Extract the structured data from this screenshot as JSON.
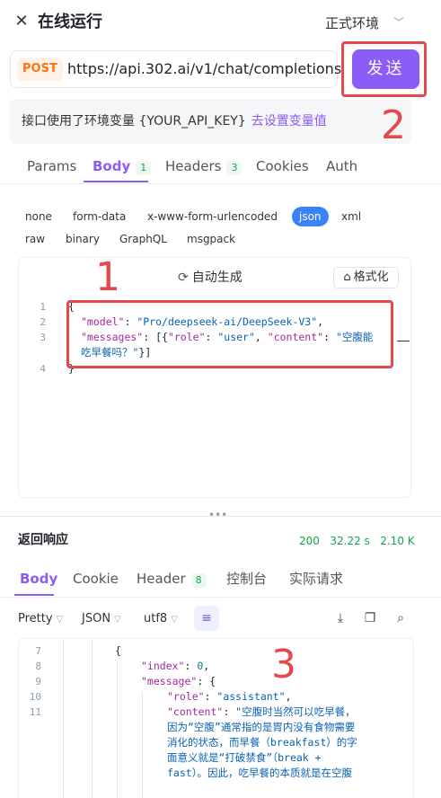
{
  "header": {
    "title": "在线运行",
    "environment": "正式环境"
  },
  "request": {
    "method": "POST",
    "url": "https://api.302.ai/v1/chat/completions",
    "send_label": "发送"
  },
  "notice": {
    "text": "接口使用了环境变量 {YOUR_API_KEY}",
    "link": "去设置变量值"
  },
  "tabs": [
    {
      "label": "Params"
    },
    {
      "label": "Body",
      "count": "1"
    },
    {
      "label": "Headers",
      "count": "3"
    },
    {
      "label": "Cookies"
    },
    {
      "label": "Auth"
    }
  ],
  "body_types": [
    "none",
    "form-data",
    "x-www-form-urlencoded",
    "json",
    "xml",
    "raw",
    "binary",
    "GraphQL",
    "msgpack"
  ],
  "editor": {
    "auto_generate": "自动生成",
    "format": "格式化",
    "line_numbers": [
      "1",
      "2",
      "3",
      "4"
    ],
    "model_key": "\"model\"",
    "model_value": "\"Pro/deepseek-ai/DeepSeek-V3\"",
    "messages_key": "\"messages\"",
    "role_key": "\"role\"",
    "role_value": "\"user\"",
    "content_key": "\"content\"",
    "content_value_part1": "\"空腹能",
    "content_value_part2": "吃早餐吗？\""
  },
  "response": {
    "title": "返回响应",
    "status_code": "200",
    "time": "32.22 s",
    "size": "2.10 K",
    "tabs": [
      {
        "label": "Body"
      },
      {
        "label": "Cookie"
      },
      {
        "label": "Header",
        "count": "8"
      },
      {
        "label": "控制台"
      },
      {
        "label": "实际请求"
      }
    ],
    "options": {
      "view": "Pretty",
      "format": "JSON",
      "encoding": "utf8"
    },
    "line_numbers": [
      "7",
      "8",
      "9",
      "10",
      "11"
    ],
    "index_key": "\"index\"",
    "index_value": "0",
    "message_key": "\"message\"",
    "role_key": "\"role\"",
    "role_value": "\"assistant\"",
    "content_key": "\"content\"",
    "content_lines": [
      "\"空腹时当然可以吃早餐，",
      "因为“空腹”通常指的是胃内没有食物需要",
      "消化的状态，而早餐（breakfast）的字",
      "面意义就是“打破禁食”（break +",
      "fast）。因此，吃早餐的本质就是在空腹"
    ]
  },
  "annotations": {
    "one": "1",
    "two": "2",
    "three": "3"
  },
  "colors": {
    "accent": "#8b5cf6",
    "method": "#f97316",
    "success": "#16a34a",
    "annotation": "#e5484d"
  }
}
